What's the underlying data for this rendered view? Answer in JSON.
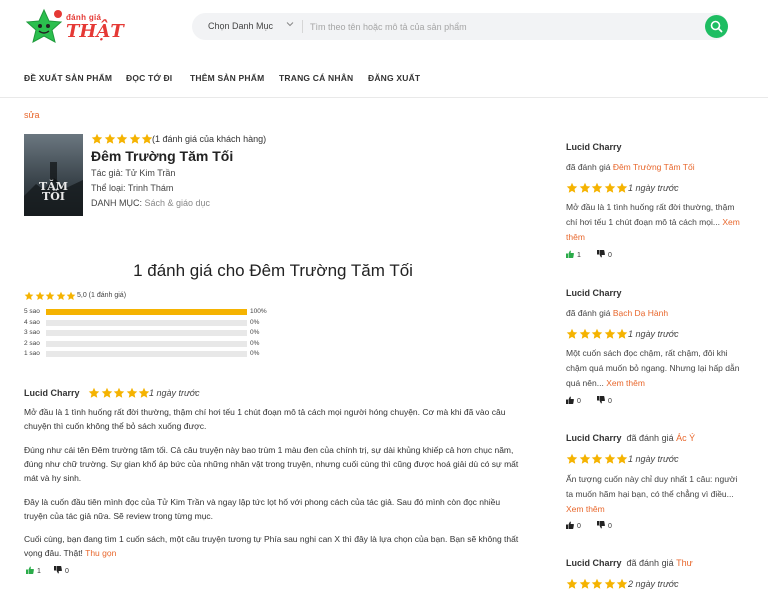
{
  "colors": {
    "accent": "#e8672c",
    "star": "#f5b301",
    "search_button": "#1ebd62",
    "logo": "#e53935"
  },
  "header": {
    "logo_top": "đánh giá",
    "logo_main": "THẬT",
    "category_select": "Chọn Danh Mục",
    "search_placeholder": "Tìm theo tên hoặc mô tả của sản phẩm"
  },
  "nav": {
    "items": [
      "Đề xuất sản phẩm",
      "Đọc tớ đi",
      "Thêm sản phẩm",
      "Trang cá nhân",
      "Đăng xuất"
    ]
  },
  "edit_link": "sửa",
  "book": {
    "rating_text": "(1 đánh giá của khách hàng)",
    "title": "Đêm Trường Tăm Tối",
    "author": "Tác giả: Tử Kim Trần",
    "genre": "Thể loại: Trinh Thám",
    "category_label": "DANH MỤC:",
    "category_value": "Sách & giáo dục",
    "cover_title_1": "TĂM",
    "cover_title_2": "TỐI",
    "rating": 5
  },
  "reviews_heading": "1 đánh giá cho Đêm Trường Tăm Tối",
  "summary": {
    "text": "5,0 (1 đánh giá)",
    "rating": 5.0,
    "distribution": [
      {
        "label": "5 sao",
        "percent": 100,
        "pct_text": "100%"
      },
      {
        "label": "4 sao",
        "percent": 0,
        "pct_text": "0%"
      },
      {
        "label": "3 sao",
        "percent": 0,
        "pct_text": "0%"
      },
      {
        "label": "2 sao",
        "percent": 0,
        "pct_text": "0%"
      },
      {
        "label": "1 sao",
        "percent": 0,
        "pct_text": "0%"
      }
    ]
  },
  "main_review": {
    "author": "Lucid Charry",
    "rating": 5,
    "time": "1 ngày trước",
    "paragraphs": [
      "Mở đầu là 1 tình huống rất đời thường, thậm chí hơi tếu 1 chút đoạn mô tả cách mọi người hóng chuyện. Cơ mà khi đã vào câu chuyện thì cuốn không thể bỏ sách xuống được.",
      "Đúng như cái tên Đêm trường tăm tối. Cả câu truyện này bao trùm 1 màu đen của chính trị, sự dài khủng khiếp cả hơn chục năm, đúng như chữ trường. Sự gian khổ áp bức của những nhân vật trong truyện, nhưng cuối cùng thì cũng được hoá giải dù có sự mất mát và hy sinh.",
      "Đây là cuốn đầu tiên mình đọc của Tử Kim Trần và ngay lập tức lọt hố với phong cách của tác giả. Sau đó mình còn đọc nhiều truyện của tác giả nữa. Sẽ review trong từng mục.",
      "Cuối cùng, bạn đang tìm 1 cuốn sách, một câu truyện tương tự Phía sau nghi can X thì đây là lựa chọn của bạn. Bạn sẽ không thất vọng đâu. Thật!"
    ],
    "less_link": "Thu gọn",
    "likes": "1",
    "dislikes": "0"
  },
  "sidebar": [
    {
      "author": "Lucid Charry",
      "reviewed_prefix": "đã đánh giá",
      "product": "Đêm Trường Tăm Tối",
      "rating": 5,
      "time": "1 ngày trước",
      "body": "Mở đầu là 1 tình huống rất đời thường, thậm chí hơi tếu 1 chút đoạn mô tả cách mọi...",
      "more": "Xem thêm",
      "likes": "1",
      "dislikes": "0"
    },
    {
      "author": "Lucid Charry",
      "reviewed_prefix": "đã đánh giá",
      "product": "Bạch Dạ Hành",
      "rating": 5,
      "time": "1 ngày trước",
      "body": "Một cuốn sách đọc chậm, rất chậm, đôi khi chậm quá muốn bỏ ngang. Nhưng lại hấp dẫn quá nên...",
      "more": "Xem thêm",
      "likes": "0",
      "dislikes": "0"
    },
    {
      "author": "Lucid Charry",
      "reviewed_prefix": "đã đánh giá",
      "product": "Ác Ý",
      "rating": 5,
      "time": "1 ngày trước",
      "body": "Ấn tượng cuốn này chỉ duy nhất 1 câu: người ta muốn hãm hại bạn, có thể chẳng vì điều...",
      "more": "Xem thêm",
      "likes": "0",
      "dislikes": "0"
    },
    {
      "author": "Lucid Charry",
      "reviewed_prefix": "đã đánh giá",
      "product": "Thư",
      "rating": 5,
      "time": "2 ngày trước"
    }
  ]
}
